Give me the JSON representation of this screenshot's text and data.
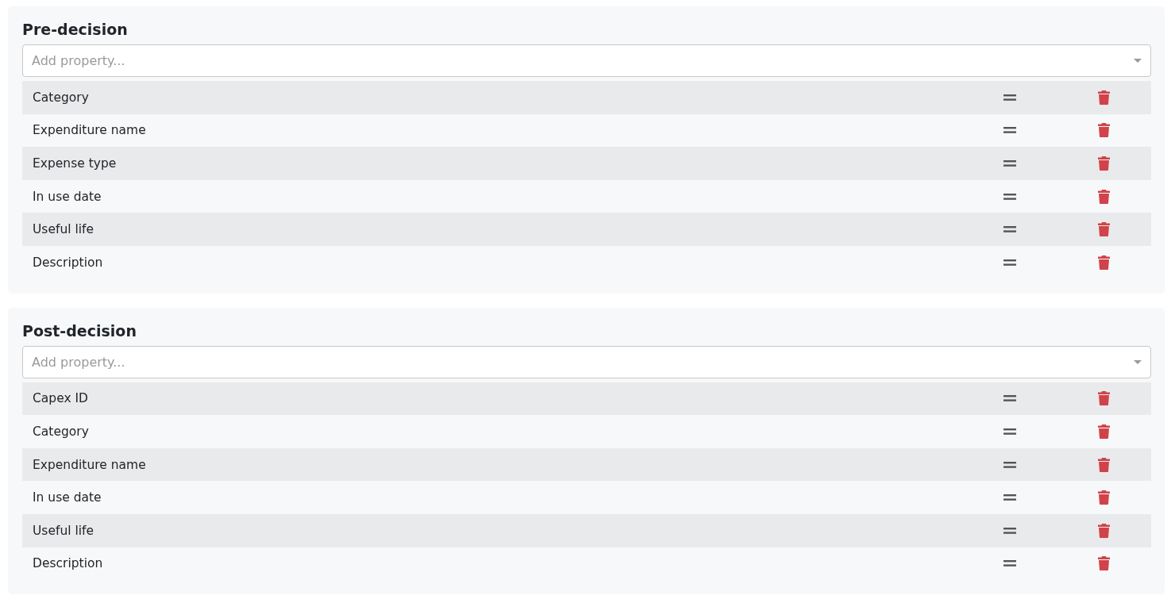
{
  "sections": [
    {
      "title": "Pre-decision",
      "search": {
        "placeholder": "Add property..."
      },
      "rows": [
        {
          "label": "Category"
        },
        {
          "label": "Expenditure name"
        },
        {
          "label": "Expense type"
        },
        {
          "label": "In use date"
        },
        {
          "label": "Useful life"
        },
        {
          "label": "Description"
        }
      ]
    },
    {
      "title": "Post-decision",
      "search": {
        "placeholder": "Add property..."
      },
      "rows": [
        {
          "label": "Capex ID"
        },
        {
          "label": "Category"
        },
        {
          "label": "Expenditure name"
        },
        {
          "label": "In use date"
        },
        {
          "label": "Useful life"
        },
        {
          "label": "Description"
        }
      ]
    }
  ]
}
